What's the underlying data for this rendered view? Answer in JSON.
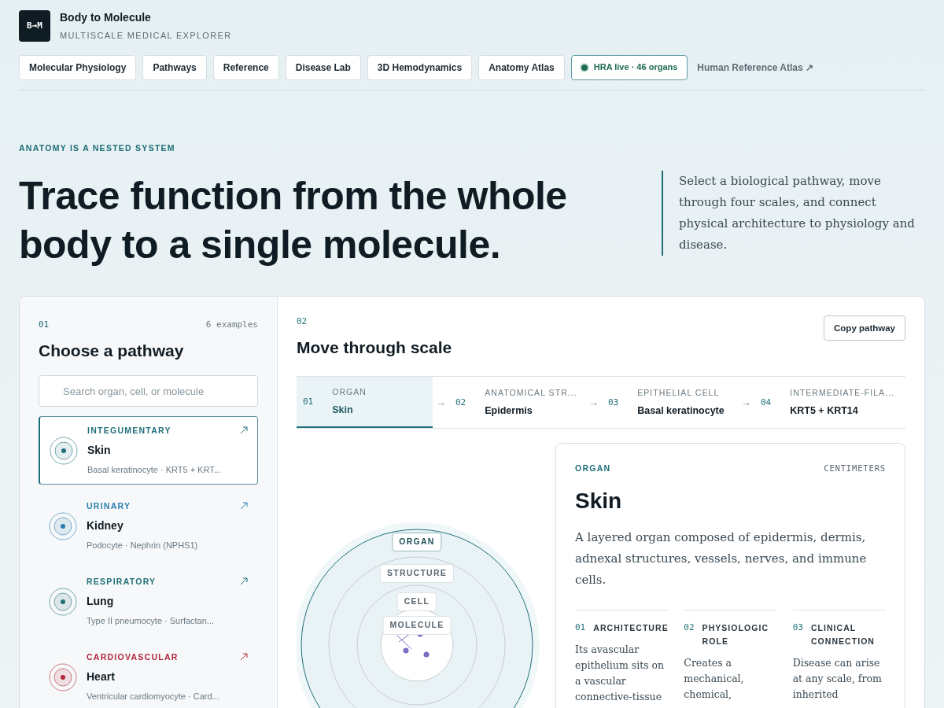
{
  "brand": {
    "logo": "B→M",
    "title": "Body to Molecule",
    "subtitle": "MULTISCALE MEDICAL EXPLORER"
  },
  "nav": [
    {
      "label": "Molecular Physiology"
    },
    {
      "label": "Pathways"
    },
    {
      "label": "Reference"
    },
    {
      "label": "Disease Lab"
    },
    {
      "label": "3D Hemodynamics"
    },
    {
      "label": "Anatomy Atlas"
    }
  ],
  "status_badge": {
    "label": "HRA live · 46 organs",
    "live": true
  },
  "external_link": {
    "label": "Human Reference Atlas ↗"
  },
  "hero": {
    "eyebrow": "ANATOMY IS A NESTED SYSTEM",
    "heading": "Trace function from the whole body to a single molecule.",
    "intro": "Select a biological pathway, move through four scales, and connect physical architecture to physiology and disease."
  },
  "pathways_panel": {
    "number": "01",
    "count": "6 examples",
    "title": "Choose a pathway",
    "search": {
      "placeholder": "Search organ, cell, or molecule"
    },
    "items": [
      {
        "category": "INTEGUMENTARY",
        "name": "Skin",
        "detail": "Basal keratinocyte · KRT5 + KRT...",
        "color": "#1f6f78",
        "selected": true
      },
      {
        "category": "URINARY",
        "name": "Kidney",
        "detail": "Podocyte · Nephrin (NPHS1)",
        "color": "#2b7fb0",
        "selected": false
      },
      {
        "category": "RESPIRATORY",
        "name": "Lung",
        "detail": "Type II pneumocyte · Surfactan...",
        "color": "#1f6f78",
        "selected": false
      },
      {
        "category": "CARDIOVASCULAR",
        "name": "Heart",
        "detail": "Ventricular cardiomyocyte · Card...",
        "color": "#b3263a",
        "selected": false
      }
    ]
  },
  "scale_panel": {
    "number": "02",
    "title": "Move through scale",
    "copy_button": "Copy pathway",
    "steps": [
      {
        "index": "01",
        "label": "ORGAN",
        "value": "Skin",
        "selected": true
      },
      {
        "arrow": "→",
        "index": "02",
        "label": "ANATOMICAL STR...",
        "value": "Epidermis",
        "selected": false
      },
      {
        "arrow": "→",
        "index": "03",
        "label": "EPITHELIAL CELL",
        "value": "Basal keratinocyte",
        "selected": false
      },
      {
        "arrow": "→",
        "index": "04",
        "label": "INTERMEDIATE-FILA...",
        "value": "KRT5 + KRT14",
        "selected": false
      }
    ],
    "rings": [
      {
        "label": "ORGAN",
        "selected": true
      },
      {
        "label": "STRUCTURE",
        "selected": false
      },
      {
        "label": "CELL",
        "selected": false
      },
      {
        "label": "MOLECULE",
        "selected": false
      }
    ],
    "detail": {
      "level": "ORGAN",
      "unit": "CENTIMETERS",
      "name": "Skin",
      "description": "A layered organ composed of epidermis, dermis, adnexal structures, vessels, nerves, and immune cells.",
      "facets": [
        {
          "number": "01",
          "title": "ARCHITECTURE",
          "text": "Its avascular epithelium sits on a vascular connective-tissue"
        },
        {
          "number": "02",
          "title": "PHYSIOLOGIC ROLE",
          "text": "Creates a mechanical, chemical,"
        },
        {
          "number": "03",
          "title": "CLINICAL CONNECTION",
          "text": "Disease can arise at any scale, from inherited"
        }
      ]
    }
  }
}
